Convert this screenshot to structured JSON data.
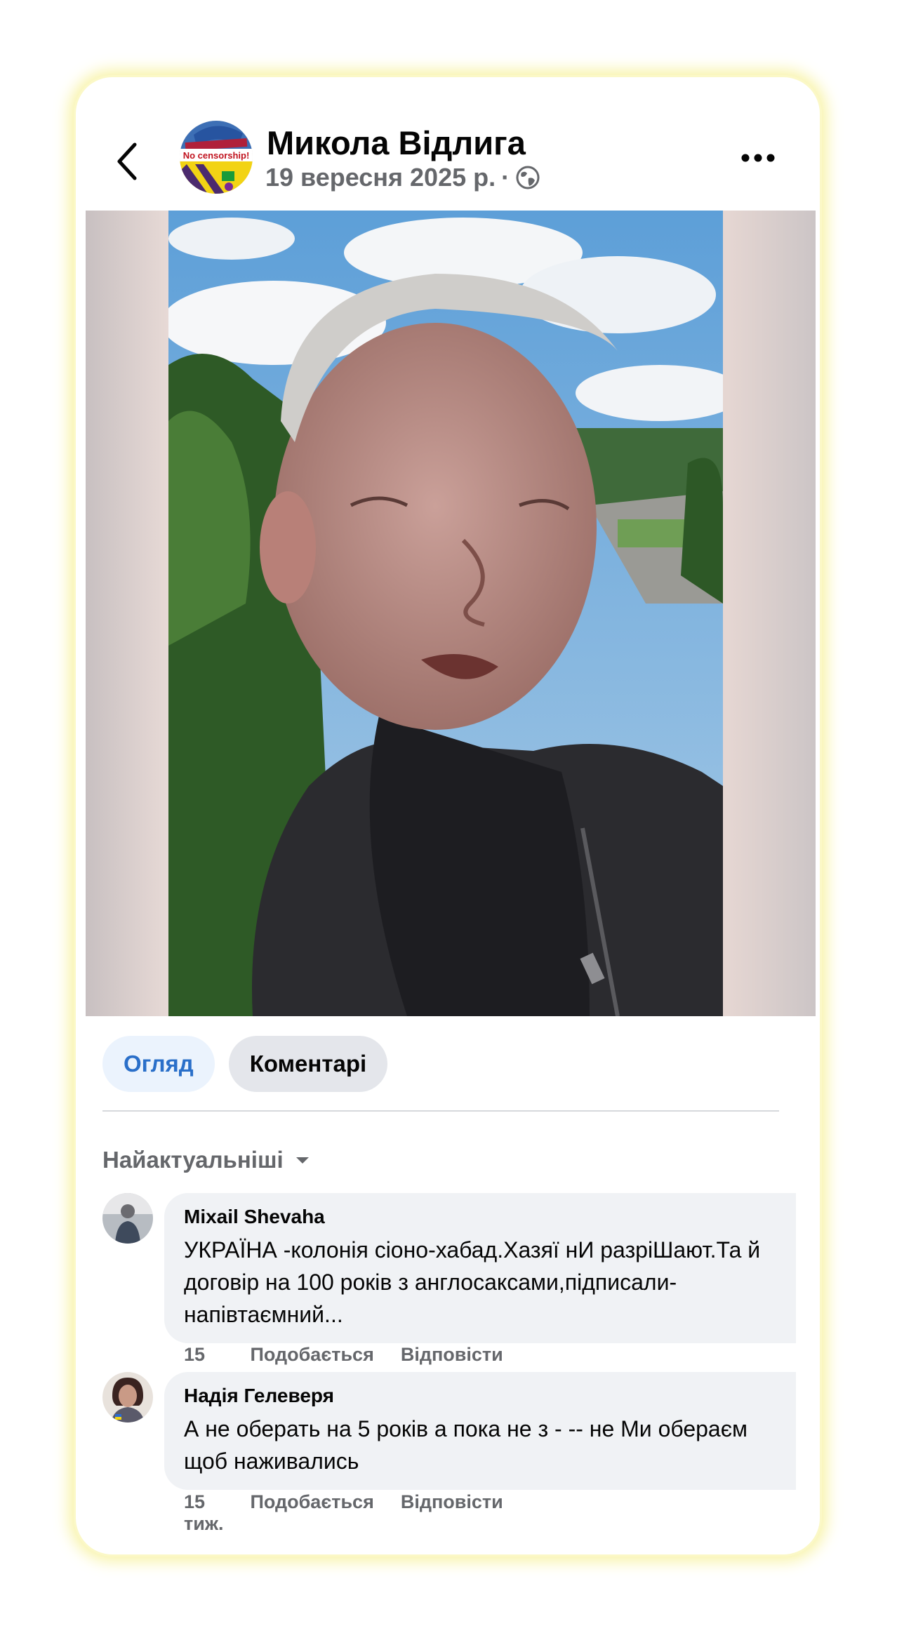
{
  "post": {
    "author": "Микола Відлига",
    "date": "19 вересня 2025 р.",
    "separator": "·",
    "privacy_icon": "globe-icon",
    "avatar_text": "No censorship!"
  },
  "tabs": [
    {
      "label": "Огляд",
      "active": true
    },
    {
      "label": "Коментарі",
      "active": false
    }
  ],
  "sort": {
    "label": "Найактуальніші"
  },
  "comments": [
    {
      "name": "Mixail Shevaha",
      "text": "УКРАЇНА -колонія сіоно-хабад.Хазяї нИ разріШают.Та й договір на 100 років з англосаксами,підписали-напівтаємний...",
      "time": "15 тиж.",
      "like": "Подобається",
      "reply": "Відповісти"
    },
    {
      "name": "Надія Гелеверя",
      "text": "А не оберать на 5 років а пока не з - -- не Ми обераєм щоб наживались",
      "time": "15 тиж.",
      "like": "Подобається",
      "reply": "Відповісти"
    }
  ],
  "colors": {
    "accent": "#2a6fc9",
    "secondary_text": "#65676b",
    "bubble": "#f0f2f5",
    "card_glow": "#f8f3a6"
  }
}
